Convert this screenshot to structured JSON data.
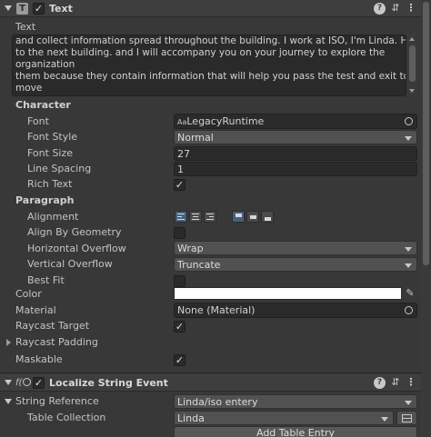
{
  "text_component": {
    "title": "Text",
    "text_label": "Text",
    "text_value_lines": [
      "and collect information spread throughout the building. I work at ISO, I'm Linda. Hi,",
      "to the next building. and I will accompany you on your journey to explore the",
      "organization",
      "them because they contain information that will help you pass the test and exit to",
      "move"
    ],
    "character_header": "Character",
    "font_label": "Font",
    "font_icon_text": "Aa",
    "font_value": "LegacyRuntime",
    "font_style_label": "Font Style",
    "font_style_value": "Normal",
    "font_size_label": "Font Size",
    "font_size_value": "27",
    "line_spacing_label": "Line Spacing",
    "line_spacing_value": "1",
    "rich_text_label": "Rich Text",
    "rich_text_checked": true,
    "paragraph_header": "Paragraph",
    "alignment_label": "Alignment",
    "align_by_geometry_label": "Align By Geometry",
    "align_by_geometry_checked": false,
    "horizontal_overflow_label": "Horizontal Overflow",
    "horizontal_overflow_value": "Wrap",
    "vertical_overflow_label": "Vertical Overflow",
    "vertical_overflow_value": "Truncate",
    "best_fit_label": "Best Fit",
    "best_fit_checked": false,
    "color_label": "Color",
    "color_value": "#ffffff",
    "material_label": "Material",
    "material_value": "None (Material)",
    "raycast_target_label": "Raycast Target",
    "raycast_target_checked": true,
    "raycast_padding_label": "Raycast Padding",
    "maskable_label": "Maskable",
    "maskable_checked": true
  },
  "localize_component": {
    "title": "Localize String Event",
    "string_reference_label": "String Reference",
    "string_reference_value": "Linda/iso entery",
    "table_collection_label": "Table Collection",
    "table_collection_value": "Linda",
    "add_table_entry_label": "Add Table Entry"
  },
  "checkmark_glyph": "✓",
  "colors": {
    "background": "#383838",
    "field": "#2a2a2a",
    "selected_accent": "#46607c"
  }
}
